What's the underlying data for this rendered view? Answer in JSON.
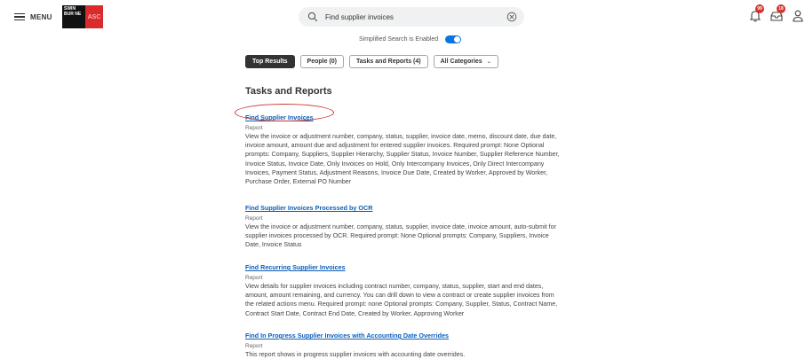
{
  "header": {
    "menu_label": "MENU",
    "logo_text": "SWIN BUR NE",
    "logo_accent": "ASC",
    "search": {
      "value": "Find supplier invoices",
      "placeholder": "Search"
    },
    "notifications": [
      {
        "icon": "bell-icon",
        "count": "99"
      },
      {
        "icon": "inbox-icon",
        "count": "18"
      }
    ],
    "user_icon": "user-icon",
    "colors": {
      "badge": "#d1332e",
      "accent": "#0875e1"
    }
  },
  "simplified_search": {
    "label": "Simplified Search is Enabled",
    "enabled": true
  },
  "tabs": [
    {
      "label": "Top Results",
      "active": true
    },
    {
      "label": "People (0)",
      "active": false
    },
    {
      "label": "Tasks and Reports (4)",
      "active": false
    },
    {
      "label": "All Categories",
      "active": false,
      "dropdown": true
    }
  ],
  "section": {
    "title": "Tasks and Reports"
  },
  "results": [
    {
      "title": "Find Supplier Invoices",
      "type": "Report",
      "description": "View the invoice or adjustment number, company, status, supplier, invoice date, memo, discount date, due date, invoice amount, amount due and adjustment for entered supplier invoices. Required prompt: None Optional prompts: Company, Suppliers, Supplier Hierarchy, Supplier Status, Invoice Number, Supplier Reference Number, Invoice Status, Invoice Date, Only Invoices on Hold, Only Intercompany Invoices, Only Direct Intercompany Invoices, Payment Status, Adjustment Reasons, Invoice Due Date, Created by Worker, Approved by Worker, Purchase Order, External PO Number"
    },
    {
      "title": "Find Supplier Invoices Processed by OCR",
      "type": "Report",
      "description": "View the invoice or adjustment number, company, status, supplier, invoice date, invoice amount, auto-submit for supplier invoices processed by OCR. Required prompt: None Optional prompts: Company, Suppliers, Invoice Date, Invoice Status"
    },
    {
      "title": "Find Recurring Supplier Invoices",
      "type": "Report",
      "description": "View details for supplier invoices including contract number, company, status, supplier, start and end dates, amount, amount remaining, and currency. You can drill down to view a contract or create supplier invoices from the related actions menu. Required prompt: none Optional prompts: Company, Supplier, Status, Contract Name, Contract Start Date, Contract End Date, Created by Worker, Approving Worker"
    },
    {
      "title": "Find In Progress Supplier Invoices with Accounting Date Overrides",
      "type": "Report",
      "description": "This report shows in progress supplier invoices with accounting date overrides."
    }
  ]
}
